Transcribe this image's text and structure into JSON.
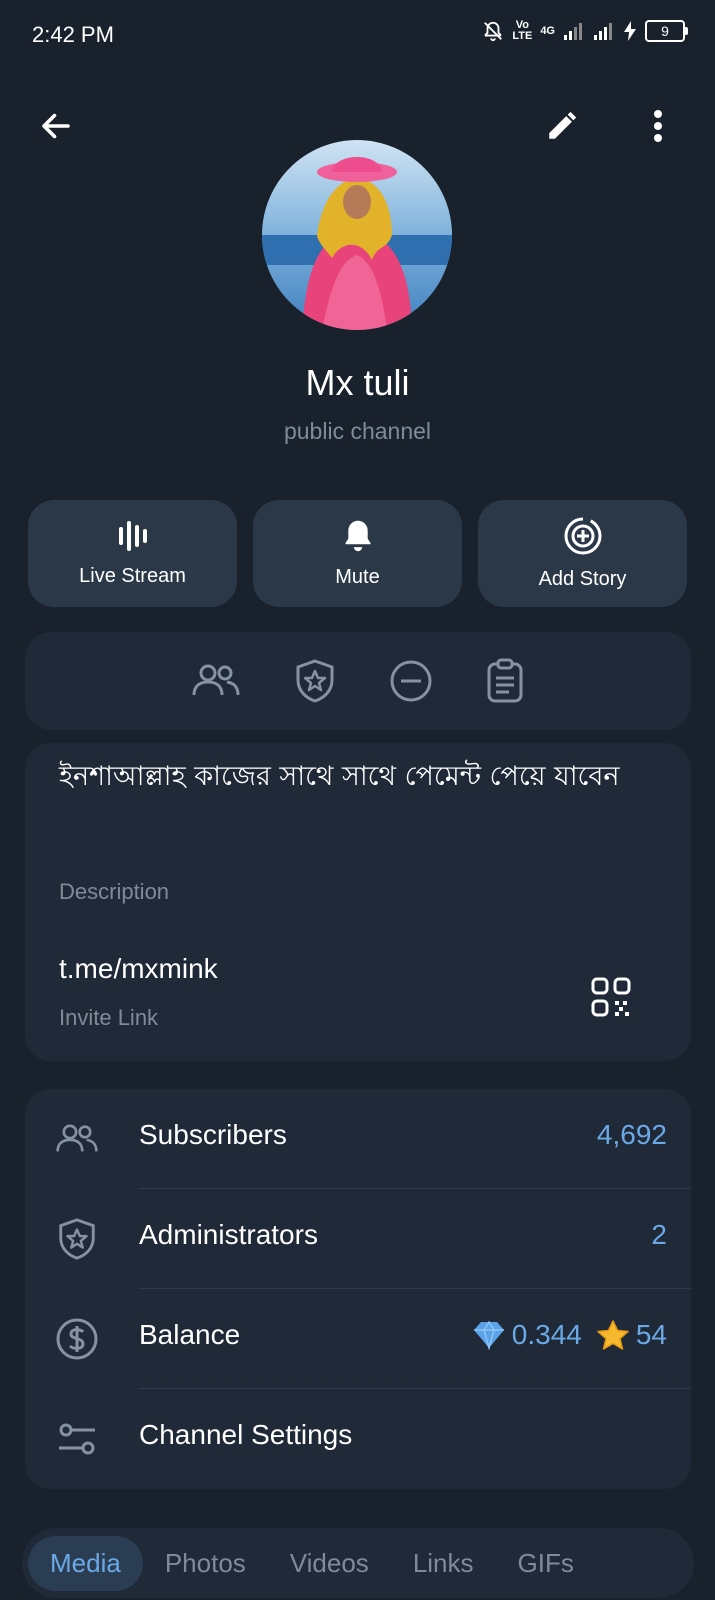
{
  "status_bar": {
    "time": "2:42 PM",
    "network_top": "Vo",
    "network_bottom": "LTE",
    "network2_top": "4G",
    "battery": "9"
  },
  "header": {
    "channel_name": "Mx tuli",
    "channel_type": "public channel"
  },
  "actions": [
    {
      "label": "Live Stream",
      "icon": "live-stream-icon"
    },
    {
      "label": "Mute",
      "icon": "bell-icon"
    },
    {
      "label": "Add Story",
      "icon": "add-story-icon"
    }
  ],
  "info": {
    "description": "ইনশাআল্লাহ কাজের সাথে সাথে পেমেন্ট পেয়ে যাবেন",
    "description_label": "Description",
    "invite_link": "t.me/mxmink",
    "invite_label": "Invite Link"
  },
  "list": {
    "subscribers_label": "Subscribers",
    "subscribers_value": "4,692",
    "administrators_label": "Administrators",
    "administrators_value": "2",
    "balance_label": "Balance",
    "balance_ton": "0.344",
    "balance_stars": "54",
    "settings_label": "Channel Settings"
  },
  "tabs": [
    {
      "label": "Media",
      "active": true
    },
    {
      "label": "Photos",
      "active": false
    },
    {
      "label": "Videos",
      "active": false
    },
    {
      "label": "Links",
      "active": false
    },
    {
      "label": "GIFs",
      "active": false
    }
  ],
  "colors": {
    "background": "#18212c",
    "card": "#1f2937",
    "button": "#2a3848",
    "accent": "#6aa9e6",
    "muted": "#7f8b98"
  }
}
